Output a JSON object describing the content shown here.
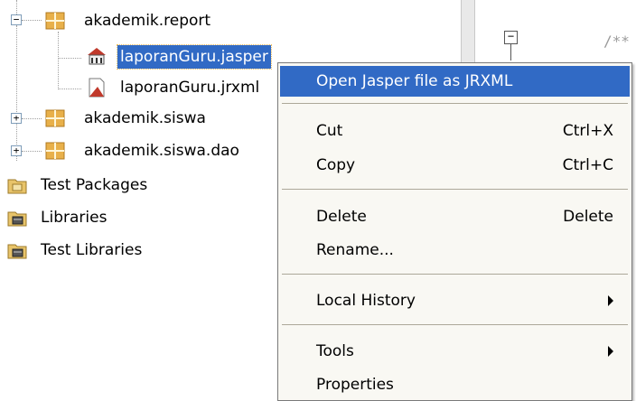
{
  "tree": {
    "items": [
      {
        "label": "akademik.report"
      },
      {
        "label": "laporanGuru.jasper"
      },
      {
        "label": "laporanGuru.jrxml"
      },
      {
        "label": "akademik.siswa"
      },
      {
        "label": "akademik.siswa.dao"
      },
      {
        "label": "Test Packages"
      },
      {
        "label": "Libraries"
      },
      {
        "label": "Test Libraries"
      }
    ],
    "expander_expanded": "−",
    "expander_collapsed": "+"
  },
  "editor": {
    "fold_glyph": "−",
    "code_fragment": "/**"
  },
  "context_menu": {
    "items": [
      {
        "label": "Open Jasper file as JRXML",
        "shortcut": ""
      },
      {
        "label": "Cut",
        "shortcut": "Ctrl+X"
      },
      {
        "label": "Copy",
        "shortcut": "Ctrl+C"
      },
      {
        "label": "Delete",
        "shortcut": "Delete"
      },
      {
        "label": "Rename...",
        "shortcut": ""
      },
      {
        "label": "Local History",
        "shortcut": ""
      },
      {
        "label": "Tools",
        "shortcut": ""
      },
      {
        "label": "Properties",
        "shortcut": ""
      }
    ]
  },
  "colors": {
    "selection": "#316ac5",
    "menu_background": "#f9f8f3",
    "package_icon": "#e8b04a"
  }
}
